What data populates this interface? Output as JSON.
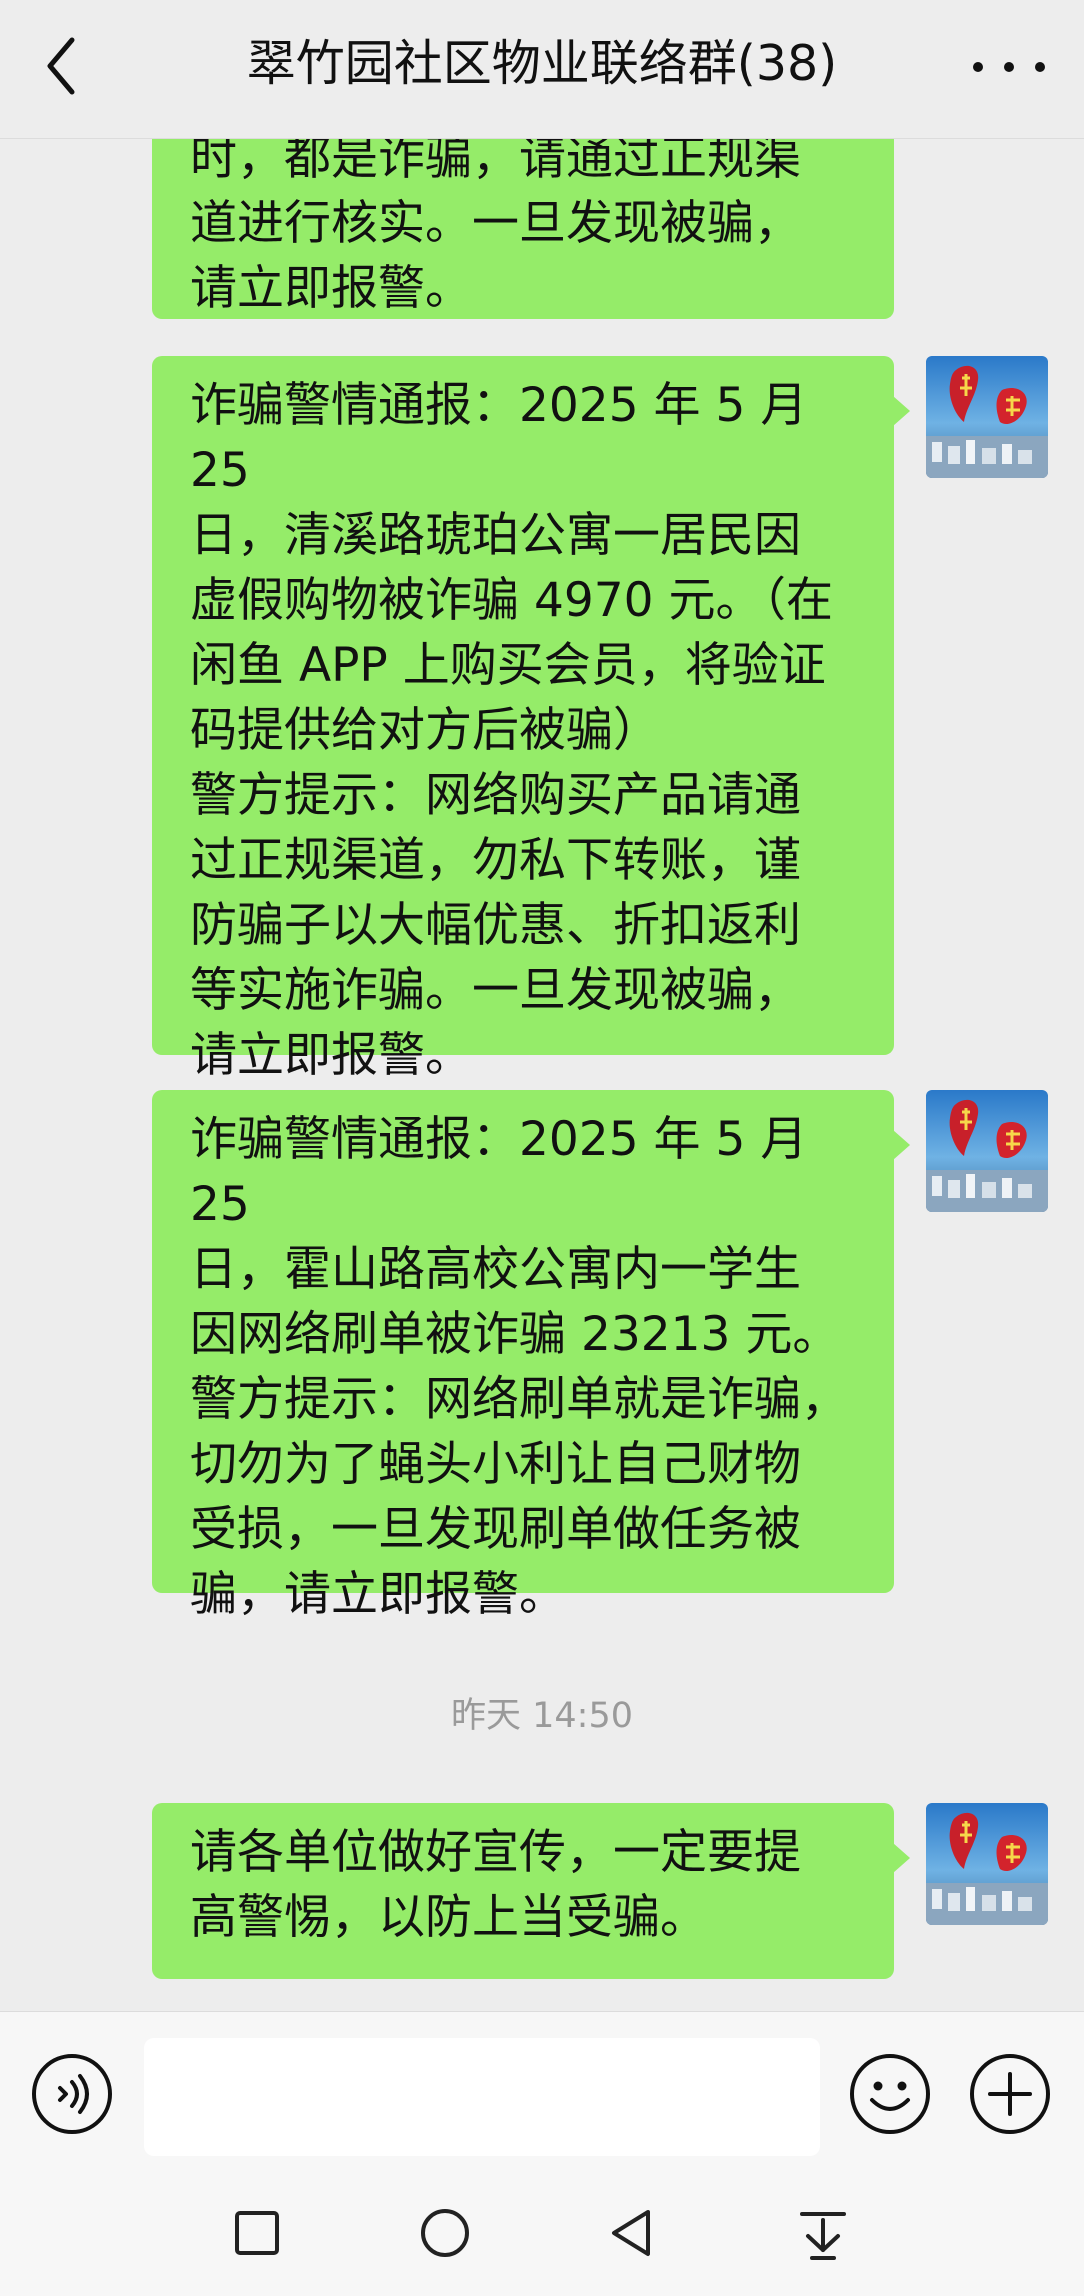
{
  "header": {
    "title": "翠竹园社区物业联络群(38)",
    "back_icon": "chevron-left-icon",
    "more_icon": "more-dots-icon"
  },
  "messages": [
    {
      "text": "时，都是诈骗，请通过正规渠\n道进行核实。一旦发现被骗，\n请立即报警。",
      "avatar": false
    },
    {
      "text": "诈骗警情通报：2025 年 5 月 25\n日，清溪路琥珀公寓一居民因\n虚假购物被诈骗 4970 元。（在\n闲鱼 APP 上购买会员，将验证\n码提供给对方后被骗）\n警方提示：网络购买产品请通\n过正规渠道，勿私下转账，谨\n防骗子以大幅优惠、折扣返利\n等实施诈骗。一旦发现被骗，\n请立即报警。",
      "avatar": true
    },
    {
      "text": "诈骗警情通报：2025 年 5 月 25\n日，霍山路高校公寓内一学生\n因网络刷单被诈骗 23213 元。\n警方提示：网络刷单就是诈骗，\n切勿为了蝇头小利让自己财物\n受损，一旦发现刷单做任务被\n骗，请立即报警。",
      "avatar": true
    },
    {
      "text": "请各单位做好宣传，一定要提\n高警惕，以防上当受骗。",
      "avatar": true
    }
  ],
  "timestamp": "昨天 14:50",
  "input_bar": {
    "message_value": "",
    "voice_icon": "voice-icon",
    "emoji_icon": "emoji-smile-icon",
    "plus_icon": "plus-circle-icon"
  },
  "navbar": {
    "icons": [
      "square-icon",
      "circle-icon",
      "triangle-back-icon",
      "hide-keyboard-icon"
    ]
  },
  "colors": {
    "bubble_green": "#95ec69",
    "background": "#ededed",
    "timestamp_gray": "#9a9a9a"
  }
}
